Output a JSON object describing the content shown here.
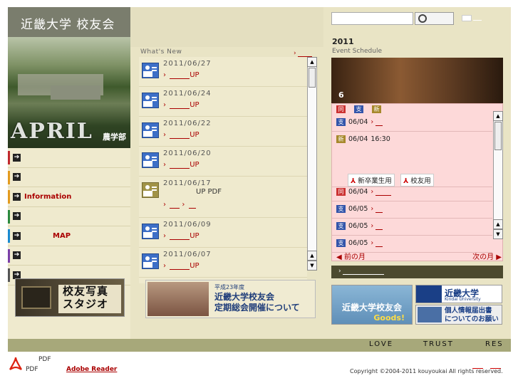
{
  "header": {
    "logo_text": "近畿大学 校友会"
  },
  "hero": {
    "month": "APRIL",
    "faculty": "農学部"
  },
  "left_menu": {
    "items": [
      {
        "label": "",
        "color": "#c0292e"
      },
      {
        "label": "",
        "color": "#e39b1f"
      },
      {
        "label": "Information",
        "color": "#e39b1f"
      },
      {
        "label": "",
        "color": "#2b8a3e"
      },
      {
        "label": "MAP",
        "color": "#1a8ad0"
      },
      {
        "label": "",
        "color": "#7a3fa8"
      },
      {
        "label": "",
        "color": "#555555"
      }
    ]
  },
  "studio_banner": {
    "line1": "校友写真",
    "line2": "スタジオ"
  },
  "whats_new": {
    "heading": "What's New",
    "more": "›",
    "items": [
      {
        "date": "2011/06/27",
        "link": "UP",
        "type": "news"
      },
      {
        "date": "2011/06/24",
        "link": "UP",
        "type": "news"
      },
      {
        "date": "2011/06/22",
        "link": "UP",
        "type": "news"
      },
      {
        "date": "2011/06/20",
        "link": "UP",
        "type": "news"
      },
      {
        "date": "2011/06/17",
        "link": "UP PDF",
        "type": "pdf"
      },
      {
        "date": "2011/06/09",
        "link": "UP",
        "type": "news"
      },
      {
        "date": "2011/06/07",
        "link": "UP",
        "type": "news"
      }
    ]
  },
  "meeting_banner": {
    "line1": "平成23年度",
    "line2": "近畿大学校友会",
    "line3": "定期総会開催について"
  },
  "search": {
    "placeholder": ""
  },
  "events": {
    "year": "2011",
    "heading": "Event Schedule",
    "month": "6",
    "legend": [
      "同",
      "支",
      "新"
    ],
    "items": [
      {
        "tag": "支",
        "tagcolor": "b",
        "date": "06/04",
        "time": ""
      },
      {
        "tag": "新",
        "tagcolor": "y",
        "date": "06/04",
        "time": "16:30"
      },
      {
        "tag": "同",
        "tagcolor": "r",
        "date": "06/04",
        "time": ""
      },
      {
        "tag": "支",
        "tagcolor": "b",
        "date": "06/05",
        "time": ""
      },
      {
        "tag": "支",
        "tagcolor": "b",
        "date": "06/05",
        "time": ""
      },
      {
        "tag": "支",
        "tagcolor": "b",
        "date": "06/05",
        "time": ""
      }
    ],
    "pdf_new_grad": "新卒業生用",
    "pdf_alumni": "校友用",
    "prev": "前の月",
    "next": "次の月"
  },
  "right_banners": {
    "goods_line1": "近畿大学校友会",
    "goods_line2": "Goods!",
    "univ_name": "近畿大学",
    "univ_en": "Kindai University",
    "privacy_line1": "個人情報届出書",
    "privacy_line2": "についてのお願い"
  },
  "slogans": [
    "LOVE",
    "TRUST",
    "RES"
  ],
  "footer": {
    "pdf_label1": "PDF",
    "pdf_label2": "PDF",
    "adobe": "Adobe Reader",
    "copyright": "Copyright ©2004-2011 kouyoukai All rights reserved."
  }
}
